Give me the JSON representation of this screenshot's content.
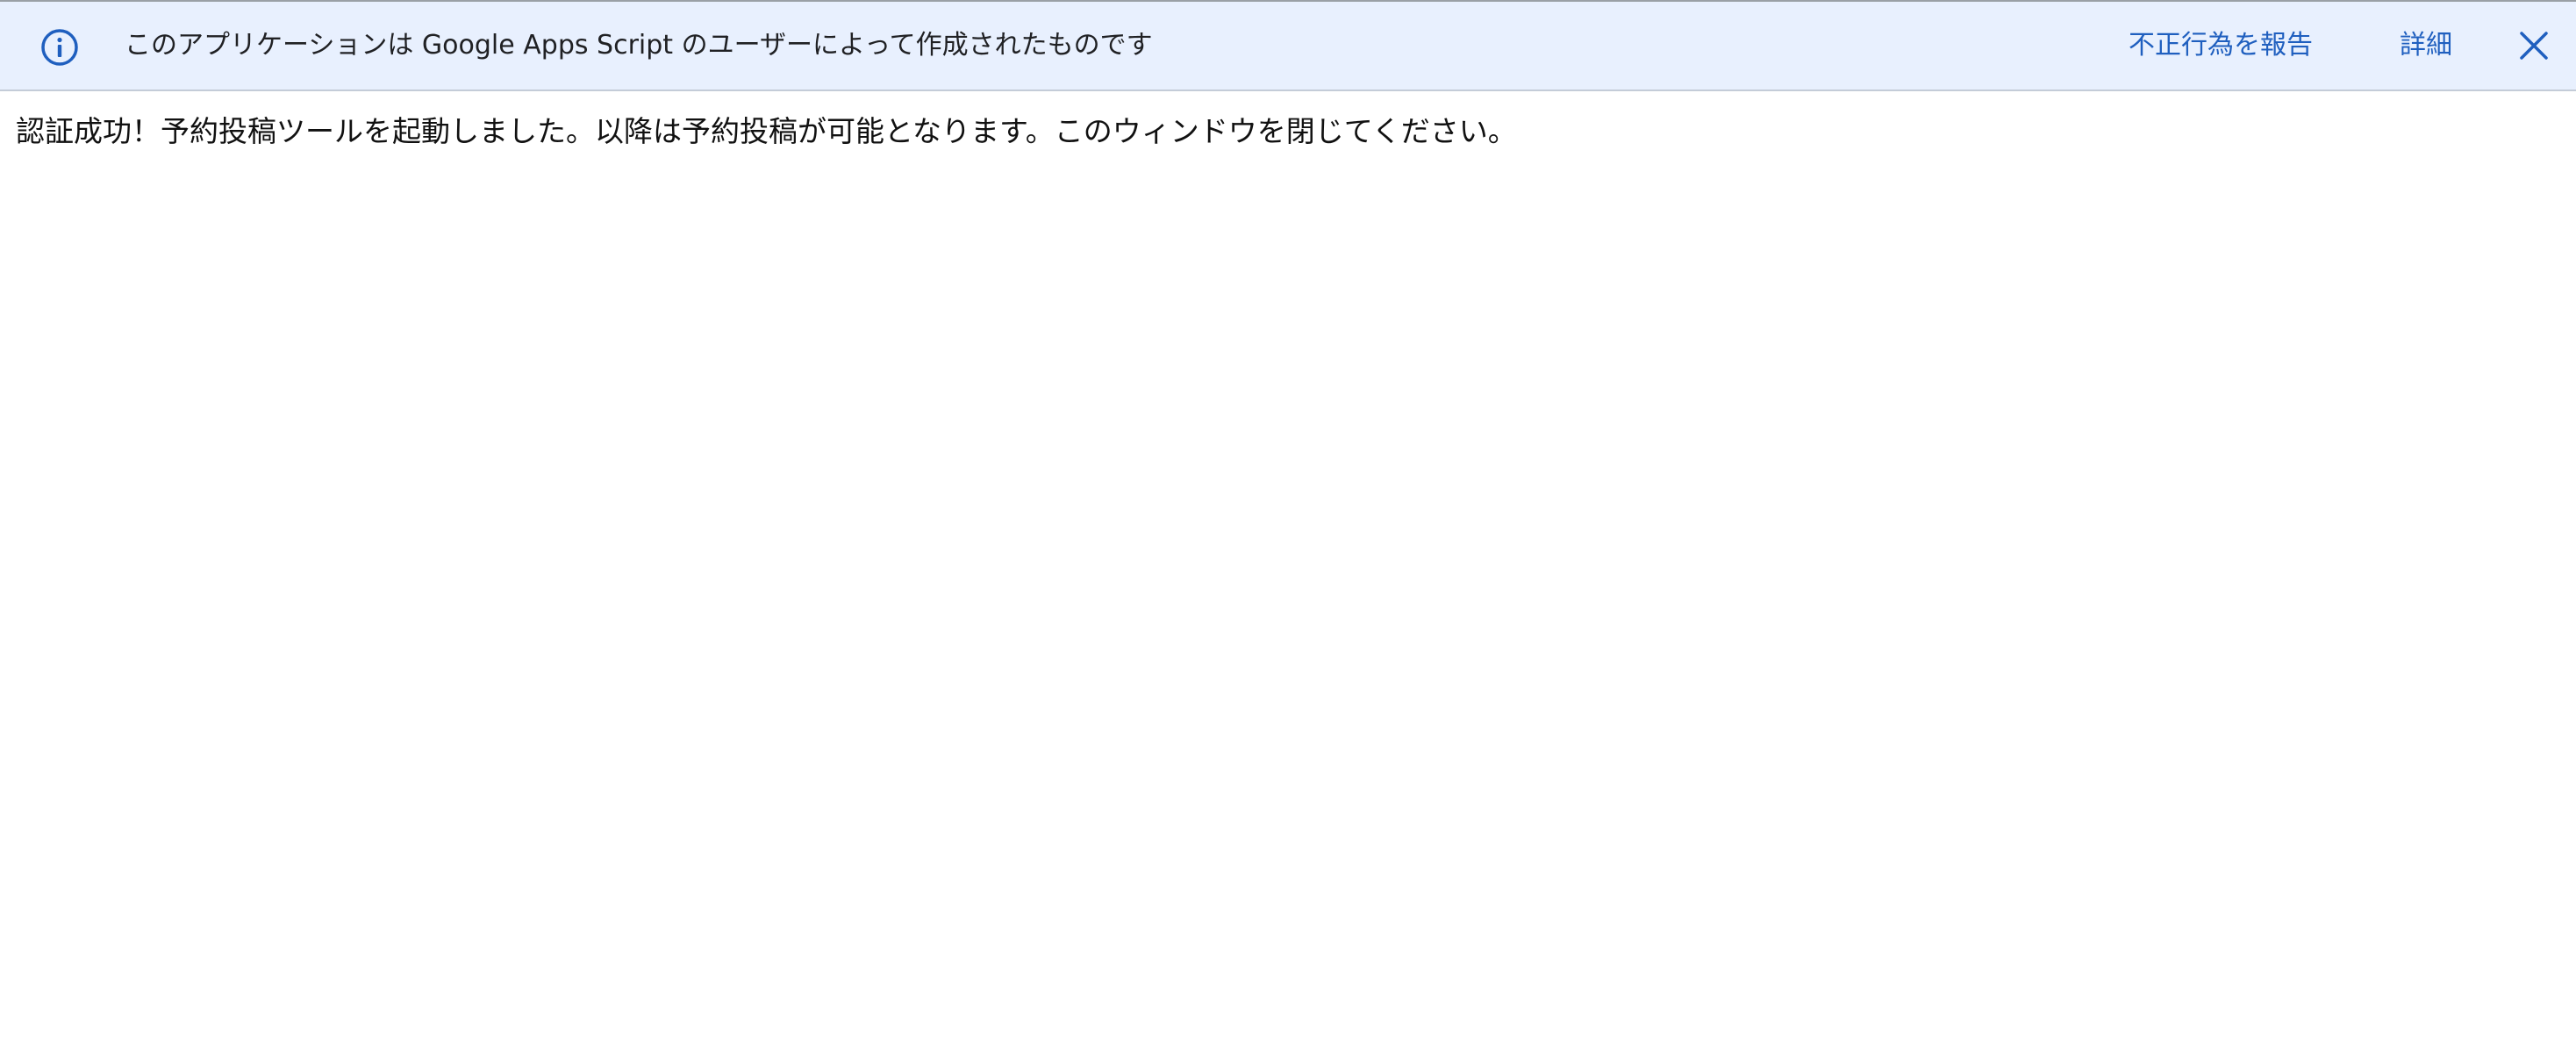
{
  "banner": {
    "message": "このアプリケーションは Google Apps Script のユーザーによって作成されたものです",
    "report_label": "不正行為を報告",
    "details_label": "詳細",
    "info_icon": "info-icon",
    "close_icon": "close-icon",
    "accent_color": "#1f5fbf",
    "background_color": "#e8f0fe"
  },
  "main": {
    "message": "認証成功！予約投稿ツールを起動しました。以降は予約投稿が可能となります。このウィンドウを閉じてください。"
  }
}
